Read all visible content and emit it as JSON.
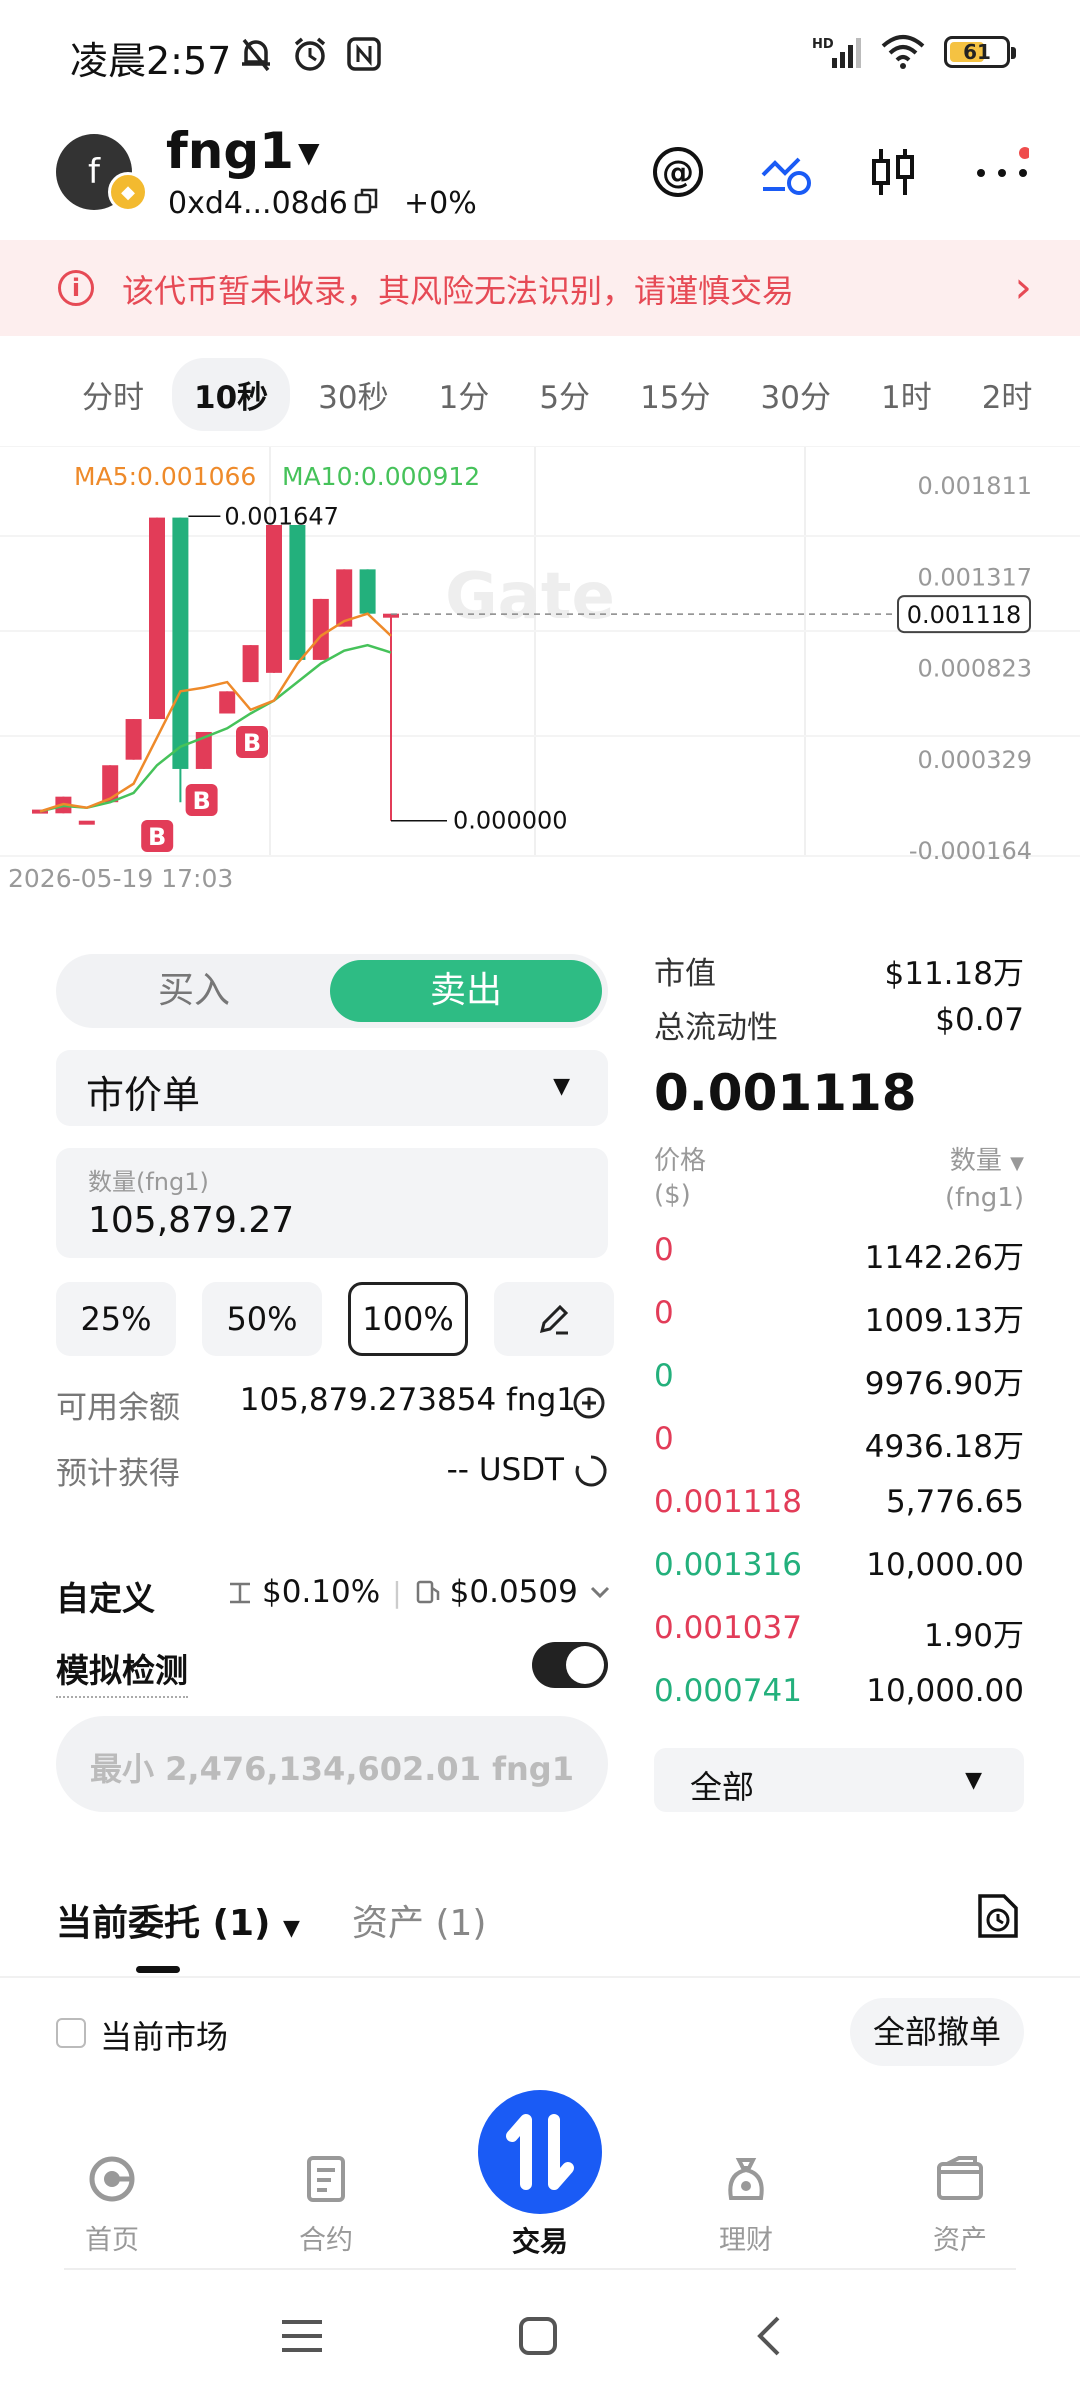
{
  "status_bar": {
    "time": "凌晨2:57",
    "battery": "61",
    "network": "HD"
  },
  "header": {
    "avatar_letter": "f",
    "token_name": "fng1",
    "address": "0xd4...08d6",
    "change": "+0%"
  },
  "warning": {
    "text": "该代币暂未收录，其风险无法识别，请谨慎交易"
  },
  "intervals": [
    "分时",
    "10秒",
    "30秒",
    "1分",
    "5分",
    "15分",
    "30分",
    "1时",
    "2时"
  ],
  "active_interval": "10秒",
  "chart_data": {
    "type": "candlestick",
    "ma5_label": "MA5:0.001066",
    "ma10_label": "MA10:0.000912",
    "y_ticks": [
      "0.001811",
      "0.001317",
      "0.000823",
      "0.000329",
      "-0.000164"
    ],
    "ylim": [
      -0.000164,
      0.001811
    ],
    "current_price_label": "0.001118",
    "high_label": "0.001647",
    "low_label": "0.000000",
    "timestamp": "2026-05-19 17:03",
    "watermark": "Gate",
    "candles": [
      {
        "o": 6e-05,
        "c": 6e-05,
        "h": 6e-05,
        "l": 6e-05,
        "up": true
      },
      {
        "o": 4e-05,
        "c": 0.00013,
        "h": 0.00013,
        "l": 4e-05,
        "up": true
      },
      {
        "o": 0.0,
        "c": 0.0,
        "h": 0.0,
        "l": 0.0,
        "up": true
      },
      {
        "o": 0.0001,
        "c": 0.0003,
        "h": 0.0003,
        "l": 0.0001,
        "up": true
      },
      {
        "o": 0.00033,
        "c": 0.00055,
        "h": 0.00055,
        "l": 0.00033,
        "up": true
      },
      {
        "o": 0.00055,
        "c": 0.00164,
        "h": 0.00164,
        "l": 0.00055,
        "up": true
      },
      {
        "o": 0.00164,
        "c": 0.00028,
        "h": 0.00164,
        "l": 0.0001,
        "up": false
      },
      {
        "o": 0.00028,
        "c": 0.00048,
        "h": 0.00048,
        "l": 0.00028,
        "up": true
      },
      {
        "o": 0.00058,
        "c": 0.0007,
        "h": 0.0007,
        "l": 0.00058,
        "up": true
      },
      {
        "o": 0.00075,
        "c": 0.00095,
        "h": 0.00095,
        "l": 0.00075,
        "up": true
      },
      {
        "o": 0.0008,
        "c": 0.0016,
        "h": 0.0016,
        "l": 0.0008,
        "up": true
      },
      {
        "o": 0.0016,
        "c": 0.00087,
        "h": 0.0016,
        "l": 0.00087,
        "up": false
      },
      {
        "o": 0.00087,
        "c": 0.0012,
        "h": 0.0012,
        "l": 0.00087,
        "up": true
      },
      {
        "o": 0.00105,
        "c": 0.00136,
        "h": 0.00136,
        "l": 0.00105,
        "up": true
      },
      {
        "o": 0.00136,
        "c": 0.00112,
        "h": 0.00136,
        "l": 0.00112,
        "up": false
      },
      {
        "o": 0.00112,
        "c": 0.00112,
        "h": 0.00112,
        "l": 0.0,
        "up": true
      }
    ],
    "ma5": [
      5e-05,
      9e-05,
      7e-05,
      0.00012,
      0.0002,
      0.00045,
      0.0007,
      0.00072,
      0.00075,
      0.0006,
      0.00065,
      0.00085,
      0.001,
      0.00108,
      0.00112,
      0.001
    ],
    "ma10": [
      5e-05,
      8e-05,
      7e-05,
      0.0001,
      0.00015,
      0.0003,
      0.0004,
      0.00045,
      0.0005,
      0.00058,
      0.00065,
      0.00075,
      0.00085,
      0.00092,
      0.00095,
      0.00091
    ],
    "buy_markers": [
      "B",
      "B",
      "B"
    ]
  },
  "trade": {
    "buy_label": "买入",
    "sell_label": "卖出",
    "order_type": "市价单",
    "qty_label": "数量(fng1)",
    "qty_value": "105,879.27",
    "percents": [
      "25%",
      "50%",
      "100%"
    ],
    "available_label": "可用余额",
    "available_value": "105,879.273854 fng1",
    "estimate_label": "预计获得",
    "estimate_value": "-- USDT",
    "custom_label": "自定义",
    "slippage": "$0.10%",
    "gas": "$0.0509",
    "sim_label": "模拟检测",
    "submit_label": "最小 2,476,134,602.01 fng1"
  },
  "market": {
    "mcap_label": "市值",
    "mcap_value": "$11.18万",
    "liq_label": "总流动性",
    "liq_value": "$0.07",
    "price": "0.001118",
    "col_price": "价格",
    "col_price_unit": "($)",
    "col_qty": "数量",
    "col_qty_unit": "(fng1)",
    "rows": [
      {
        "p": "0",
        "q": "1142.26万",
        "side": "red"
      },
      {
        "p": "0",
        "q": "1009.13万",
        "side": "red"
      },
      {
        "p": "0",
        "q": "9976.90万",
        "side": "green"
      },
      {
        "p": "0",
        "q": "4936.18万",
        "side": "red"
      },
      {
        "p": "0.001118",
        "q": "5,776.65",
        "side": "red"
      },
      {
        "p": "0.001316",
        "q": "10,000.00",
        "side": "green"
      },
      {
        "p": "0.001037",
        "q": "1.90万",
        "side": "red"
      },
      {
        "p": "0.000741",
        "q": "10,000.00",
        "side": "green"
      }
    ],
    "filter": "全部"
  },
  "orders": {
    "tab_current": "当前委托 (1)",
    "tab_assets": "资产 (1)",
    "current_market_label": "当前市场",
    "cancel_all": "全部撤单"
  },
  "nav": {
    "home": "首页",
    "futures": "合约",
    "trade": "交易",
    "finance": "理财",
    "assets": "资产"
  },
  "colors": {
    "up": "#e23c58",
    "down": "#23b07c",
    "accent": "#1a5bf5",
    "sell": "#2ebc84"
  }
}
